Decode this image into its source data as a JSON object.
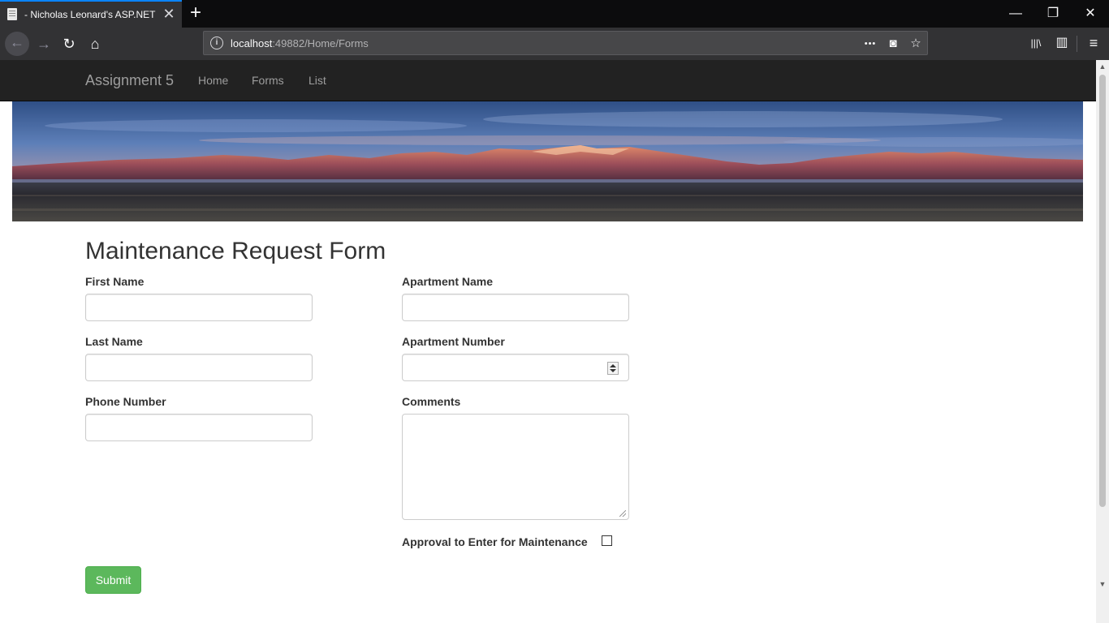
{
  "browser": {
    "tab": {
      "title": "- Nicholas Leonard's ASP.NET A",
      "close": "✕"
    },
    "new_tab": "+",
    "window_controls": {
      "minimize": "—",
      "restore": "❐",
      "close": "✕"
    },
    "nav": {
      "back": "←",
      "forward": "→",
      "reload": "↻",
      "home": "⌂"
    },
    "url": {
      "host": "localhost",
      "path": ":49882/Home/Forms",
      "info": "i"
    },
    "url_actions": {
      "more": "•••",
      "pocket": "◙",
      "bookmark": "☆"
    },
    "toolbar": {
      "library": "|||\\",
      "sidebar": "▥",
      "menu": "≡"
    }
  },
  "site": {
    "brand": "Assignment 5",
    "nav": [
      "Home",
      "Forms",
      "List"
    ]
  },
  "form": {
    "title": "Maintenance Request Form",
    "fields": {
      "first_name": {
        "label": "First Name",
        "value": ""
      },
      "last_name": {
        "label": "Last Name",
        "value": ""
      },
      "phone": {
        "label": "Phone Number",
        "value": ""
      },
      "apartment_name": {
        "label": "Apartment Name",
        "value": ""
      },
      "apartment_number": {
        "label": "Apartment Number",
        "value": ""
      },
      "comments": {
        "label": "Comments",
        "value": ""
      },
      "approval": {
        "label": "Approval to Enter for Maintenance",
        "checked": false
      }
    },
    "submit": "Submit"
  },
  "scrollbar": {
    "up": "▲",
    "down": "▼"
  }
}
